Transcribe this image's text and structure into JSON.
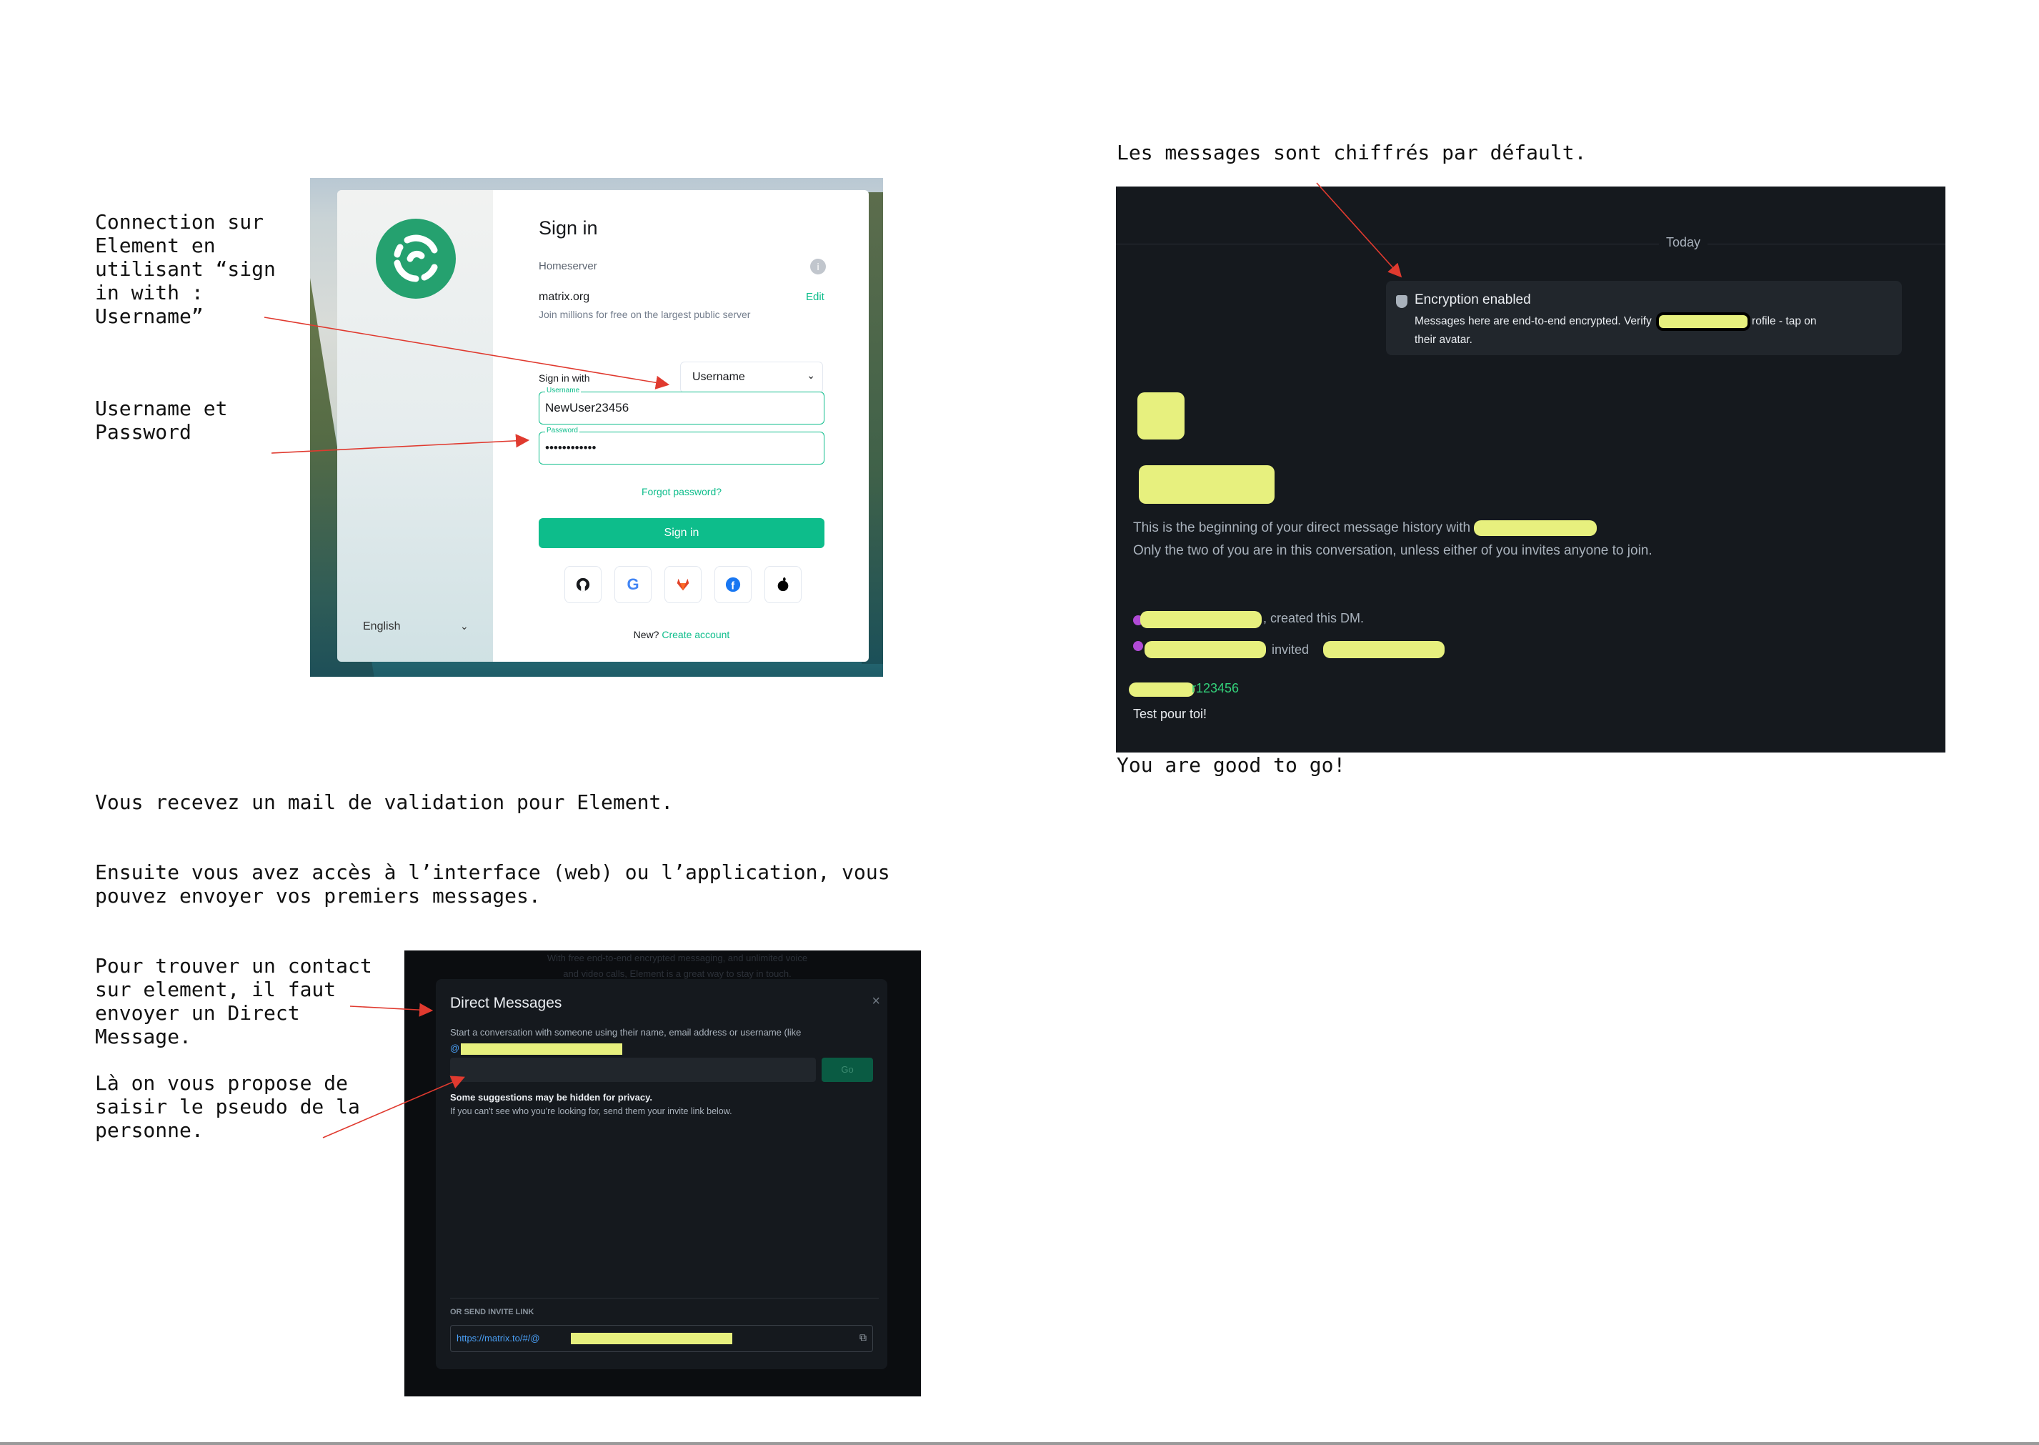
{
  "notes": {
    "connect": "Connection sur\nElement en\nutilisant “sign\nin with :\nUsername”",
    "userpass": "Username et\nPassword",
    "mail": "Vous recevez un mail de validation pour Element.",
    "access": "Ensuite vous avez accès à l’interface (web) ou l’application, vous\npouvez envoyer vos premiers messages.",
    "find_contact": "Pour trouver un contact\nsur element, il faut\nenvoyer un Direct\nMessage.",
    "propose": "Là on vous propose de\nsaisir le pseudo de la\npersonne.",
    "encrypted": "Les messages sont chiffrés par défault.",
    "good": "You are good to go!"
  },
  "signin": {
    "title": "Sign in",
    "homeserver_label": "Homeserver",
    "info_icon": "i",
    "server": "matrix.org",
    "edit": "Edit",
    "server_desc": "Join millions for free on the largest public server",
    "sign_in_with": "Sign in with",
    "method": "Username",
    "username_label": "Username",
    "username_value": "NewUser23456",
    "password_label": "Password",
    "password_value": "••••••••••••",
    "forgot": "Forgot password?",
    "button": "Sign in",
    "sso_icons": [
      "github-icon",
      "google-icon",
      "gitlab-icon",
      "facebook-icon",
      "apple-icon"
    ],
    "language": "English",
    "new_prefix": "New?",
    "create_account": "Create account",
    "brand_color": "#0dbd8b"
  },
  "chat": {
    "today": "Today",
    "enc_title": "Encryption enabled",
    "enc_body_1": "Messages here are end-to-end encrypted. Verify",
    "enc_body_2": "rofile - tap on",
    "enc_body_3": "their avatar.",
    "begin_1": "This is the beginning of your direct message history with",
    "begin_2": "Only the two of you are in this conversation, unless either of you invites anyone to join.",
    "created": ", created this DM.",
    "invited": "invited",
    "sender_tail": "r123456",
    "message": "Test pour toi!"
  },
  "dm": {
    "ghost_1": "With free end-to-end encrypted messaging, and unlimited voice",
    "ghost_2": "and video calls, Element is a great way to stay in touch.",
    "title": "Direct Messages",
    "close": "×",
    "subtitle": "Start a conversation with someone using their name, email address or username (like",
    "subtitle_at": "@",
    "go": "Go",
    "suggestions_hidden": "Some suggestions may be hidden for privacy.",
    "suggestions_help": "If you can't see who you're looking for, send them your invite link below.",
    "or_invite": "OR SEND INVITE LINK",
    "invite_link": "https://matrix.to/#/@",
    "copy_icon": "copy-icon"
  },
  "highlight_color": "#e7f07e",
  "arrow_color": "#e03a2f"
}
